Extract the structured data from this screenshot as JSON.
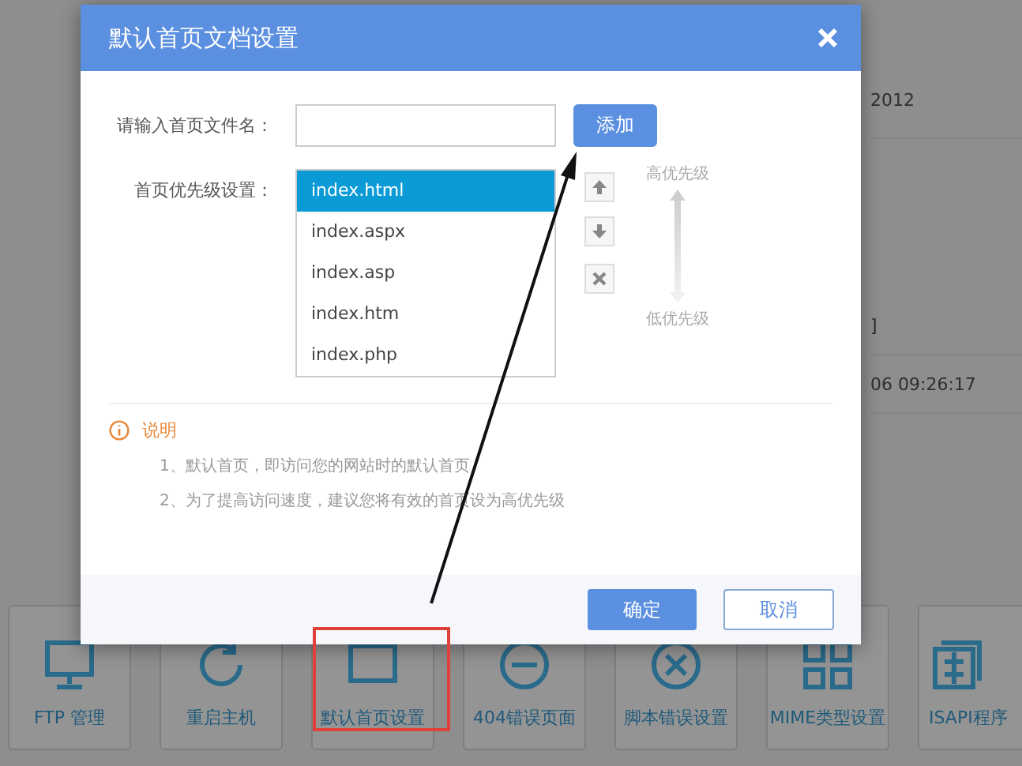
{
  "background": {
    "partial_texts": [
      {
        "text": "2012"
      },
      {
        "text": "]"
      },
      {
        "text": "06 09:26:17"
      }
    ],
    "tiles": [
      {
        "label": "FTP 管理"
      },
      {
        "label": "重启主机"
      },
      {
        "label": "默认首页设置"
      },
      {
        "label": "404错误页面"
      },
      {
        "label": "脚本错误设置"
      },
      {
        "label": "MIME类型设置"
      },
      {
        "label": "ISAPI程序"
      }
    ]
  },
  "dialog": {
    "title": "默认首页文档设置",
    "filename_label": "请输入首页文件名：",
    "add_button": "添加",
    "priority_label": "首页优先级设置：",
    "files": [
      {
        "name": "index.html",
        "selected": true
      },
      {
        "name": "index.aspx",
        "selected": false
      },
      {
        "name": "index.asp",
        "selected": false
      },
      {
        "name": "index.htm",
        "selected": false
      },
      {
        "name": "index.php",
        "selected": false
      }
    ],
    "high_priority": "高优先级",
    "low_priority": "低优先级",
    "note_title": "说明",
    "notes": [
      {
        "text": "1、默认首页，即访问您的网站时的默认首页"
      },
      {
        "text": "2、为了提高访问速度，建议您将有效的首页设为高优先级"
      }
    ],
    "confirm_button": "确定",
    "cancel_button": "取消"
  }
}
